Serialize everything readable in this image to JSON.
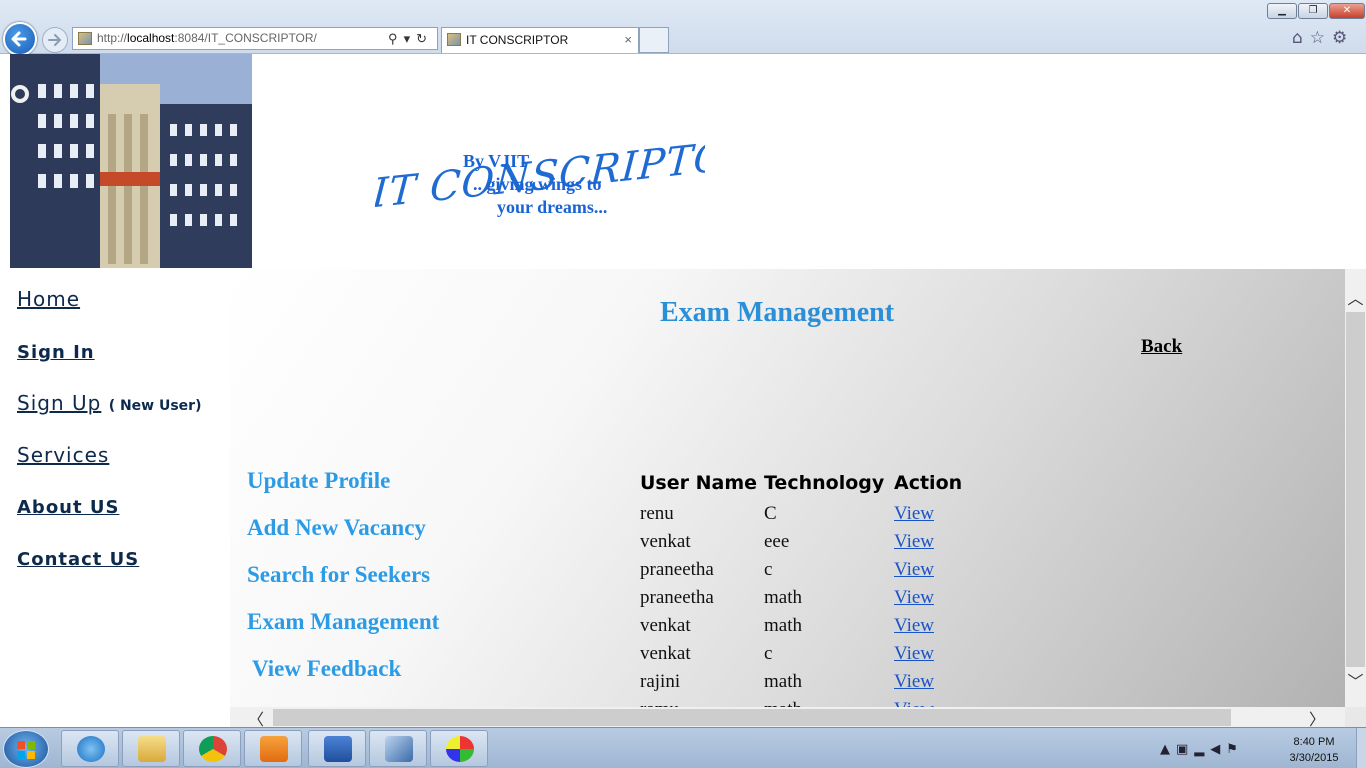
{
  "browser": {
    "url_prefix": "http://",
    "url_host": "localhost",
    "url_rest": ":8084/IT_CONSCRIPTOR/",
    "tab_title": "IT CONSCRIPTOR",
    "tab_close": "×",
    "win_min": "▁",
    "win_max": "❐",
    "win_close": "✕",
    "search_refresh_icons": "⚲▾↻"
  },
  "header": {
    "logo_text": "IT CONSCRIPTOR",
    "tagline_line1": "By VJIT",
    "tagline_line2": ".. giving wings to",
    "tagline_line3": "your dreams..."
  },
  "sidebar": {
    "home": "Home",
    "sign_in": "Sign In",
    "sign_up": "Sign Up",
    "new_user": "( New User)",
    "services": "Services",
    "about": "About US",
    "contact": "Contact US"
  },
  "main": {
    "title": "Exam Management",
    "back": "Back",
    "menu": [
      "Update Profile",
      "Add New Vacancy",
      "Search for Seekers",
      "Exam Management",
      "View Feedback"
    ],
    "table": {
      "headers": [
        "User Name",
        "Technology",
        "Action"
      ],
      "rows": [
        {
          "user": "renu",
          "tech": "C",
          "action": "View"
        },
        {
          "user": "venkat",
          "tech": "eee",
          "action": "View"
        },
        {
          "user": "praneetha",
          "tech": "c",
          "action": "View"
        },
        {
          "user": "praneetha",
          "tech": "math",
          "action": "View"
        },
        {
          "user": "venkat",
          "tech": "math",
          "action": "View"
        },
        {
          "user": "venkat",
          "tech": "c",
          "action": "View"
        },
        {
          "user": "rajini",
          "tech": "math",
          "action": "View"
        },
        {
          "user": "ramu",
          "tech": "math",
          "action": "View"
        }
      ]
    }
  },
  "taskbar": {
    "time": "8:40 PM",
    "date": "3/30/2015"
  },
  "colors": {
    "title_blue": "#2b8fd8",
    "menu_blue": "#2b9be6",
    "link_blue": "#1a53c4",
    "nav_text": "#0d2a4d",
    "tagline_blue": "#1a63d4"
  }
}
